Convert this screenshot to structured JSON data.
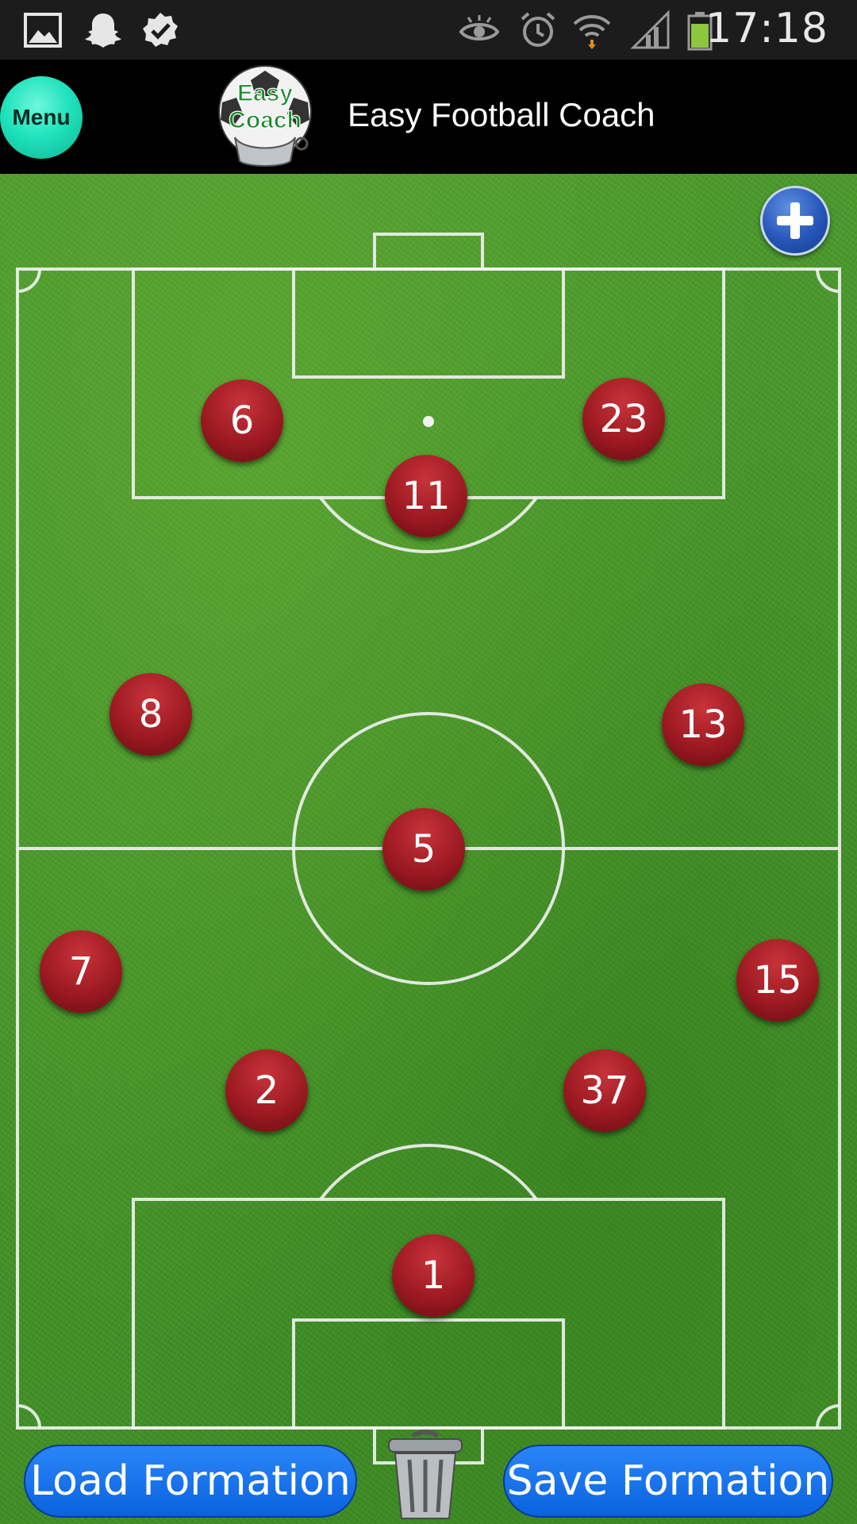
{
  "status_bar": {
    "time": "17:18",
    "left_icons": [
      "image-icon",
      "snapchat-ghost-icon",
      "check-badge-icon"
    ],
    "right_icons": [
      "eye-icon",
      "alarm-clock-icon",
      "wifi-icon",
      "signal-icon",
      "battery-icon"
    ]
  },
  "header": {
    "menu_label": "Menu",
    "logo_text_line1": "Easy",
    "logo_text_line2": "Coach",
    "title": "Easy Football Coach"
  },
  "pitch": {
    "add_player_icon": "plus-icon",
    "players": [
      {
        "number": "6"
      },
      {
        "number": "23"
      },
      {
        "number": "11"
      },
      {
        "number": "8"
      },
      {
        "number": "13"
      },
      {
        "number": "5"
      },
      {
        "number": "7"
      },
      {
        "number": "15"
      },
      {
        "number": "2"
      },
      {
        "number": "37"
      },
      {
        "number": "1"
      }
    ]
  },
  "footer": {
    "load_label": "Load Formation",
    "save_label": "Save Formation",
    "trash_icon": "trash-can-icon"
  },
  "colors": {
    "menu_button": "#20e3bd",
    "player_token": "#9d1a22",
    "formation_button": "#0a62e0",
    "pitch_green": "#4a9a2b"
  }
}
